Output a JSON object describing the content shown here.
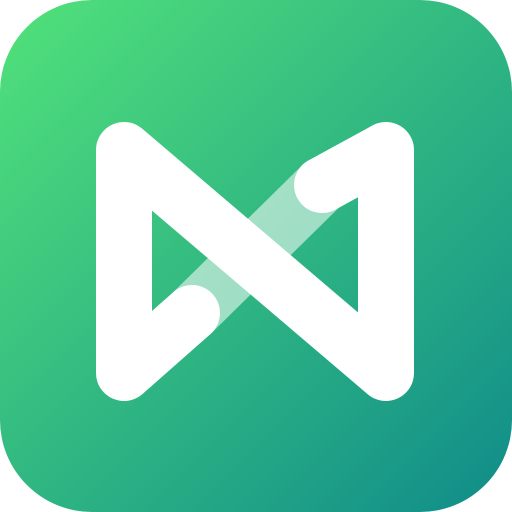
{
  "icon": {
    "name": "app-logo-icon",
    "colors": {
      "gradient_start": "#52E27A",
      "gradient_end": "#0F8C8A",
      "mark": "#FFFFFF",
      "mark_translucent": "#FFFFFF"
    }
  }
}
